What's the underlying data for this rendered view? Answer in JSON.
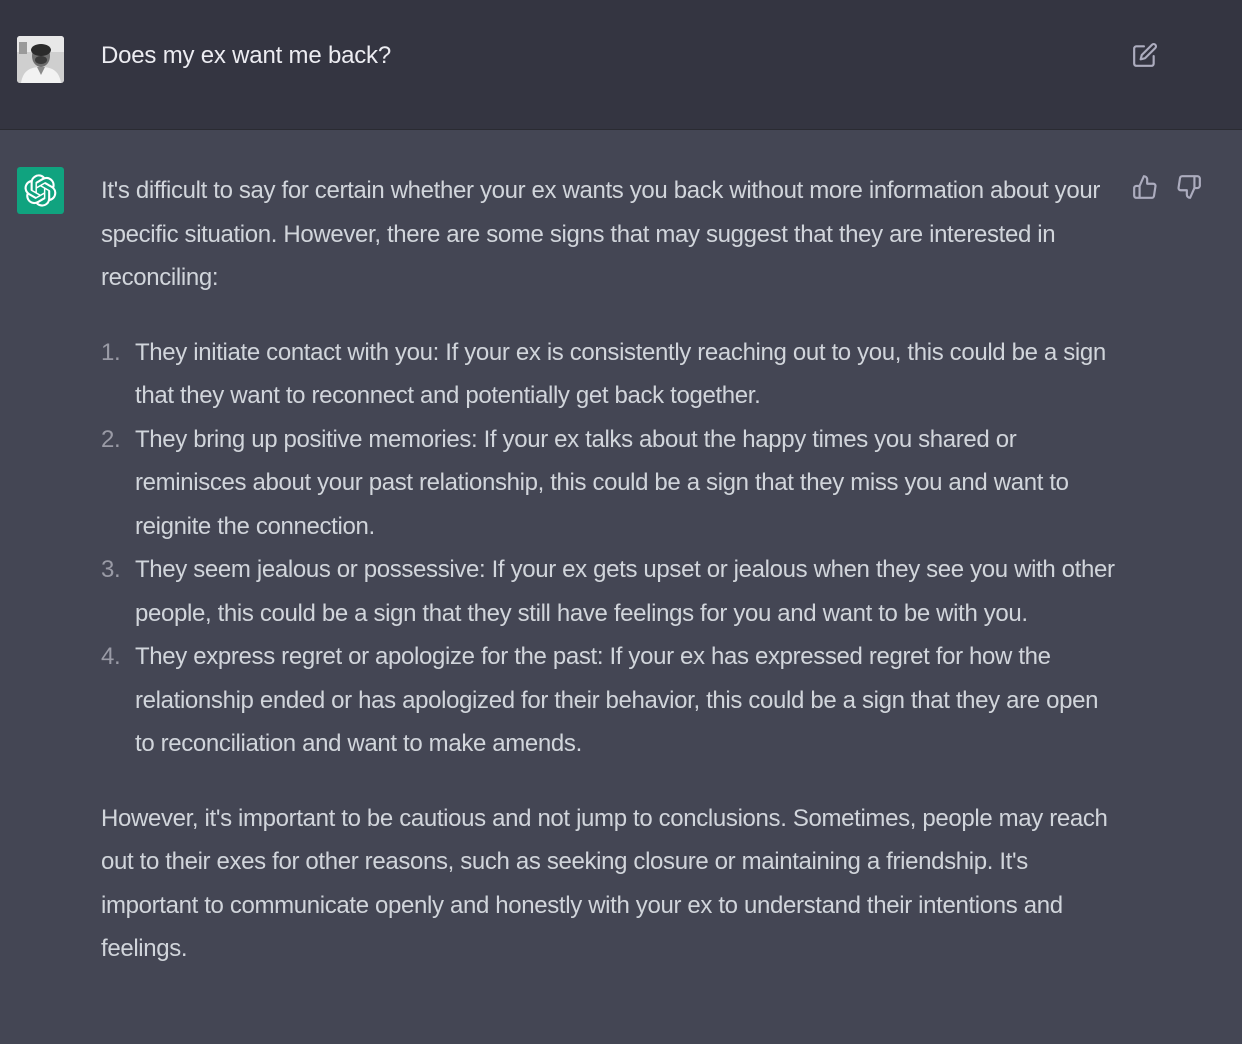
{
  "user_message": {
    "text": "Does my ex want me back?",
    "avatar_icon": "user-photo",
    "edit_icon": "edit-icon"
  },
  "assistant_message": {
    "logo_icon": "openai-logo-icon",
    "logo_color": "#10a37f",
    "feedback": {
      "thumbs_up_icon": "thumbs-up-icon",
      "thumbs_down_icon": "thumbs-down-icon"
    },
    "intro": "It's difficult to say for certain whether your ex wants you back without more information about your specific situation. However, there are some signs that may suggest that they are interested in reconciling:",
    "items": [
      {
        "number": "1.",
        "text": "They initiate contact with you: If your ex is consistently reaching out to you, this could be a sign that they want to reconnect and potentially get back together."
      },
      {
        "number": "2.",
        "text": "They bring up positive memories: If your ex talks about the happy times you shared or reminisces about your past relationship, this could be a sign that they miss you and want to reignite the connection."
      },
      {
        "number": "3.",
        "text": "They seem jealous or possessive: If your ex gets upset or jealous when they see you with other people, this could be a sign that they still have feelings for you and want to be with you."
      },
      {
        "number": "4.",
        "text": "They express regret or apologize for the past: If your ex has expressed regret for how the relationship ended or has apologized for their behavior, this could be a sign that they are open to reconciliation and want to make amends."
      }
    ],
    "conclusion": "However, it's important to be cautious and not jump to conclusions. Sometimes, people may reach out to their exes for other reasons, such as seeking closure or maintaining a friendship. It's important to communicate openly and honestly with your ex to understand their intentions and feelings."
  },
  "colors": {
    "user_bg": "#343541",
    "assistant_bg": "#444654",
    "text": "#d1d5db",
    "icon": "#acacbe"
  }
}
